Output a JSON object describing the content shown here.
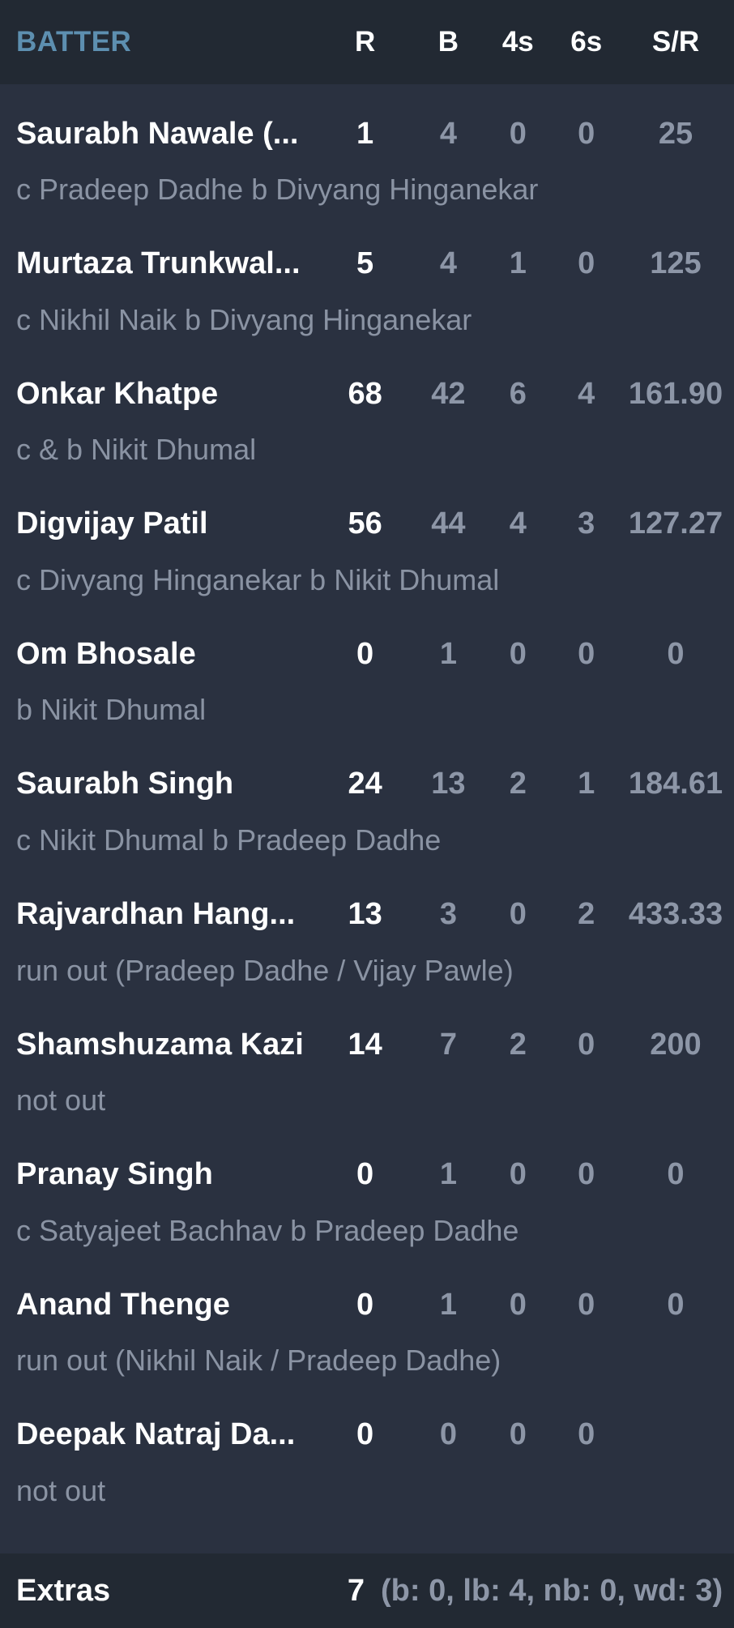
{
  "header": {
    "batter": "BATTER",
    "runs": "R",
    "balls": "B",
    "fours": "4s",
    "sixes": "6s",
    "strike_rate": "S/R"
  },
  "batters": [
    {
      "name": "Saurabh Nawale (...",
      "r": "1",
      "b": "4",
      "fours": "0",
      "sixes": "0",
      "sr": "25",
      "dismissal": "c Pradeep Dadhe b Divyang Hinganekar"
    },
    {
      "name": "Murtaza Trunkwal...",
      "r": "5",
      "b": "4",
      "fours": "1",
      "sixes": "0",
      "sr": "125",
      "dismissal": "c Nikhil Naik b Divyang Hinganekar"
    },
    {
      "name": "Onkar Khatpe",
      "r": "68",
      "b": "42",
      "fours": "6",
      "sixes": "4",
      "sr": "161.90",
      "dismissal": "c & b Nikit Dhumal"
    },
    {
      "name": "Digvijay Patil",
      "r": "56",
      "b": "44",
      "fours": "4",
      "sixes": "3",
      "sr": "127.27",
      "dismissal": "c Divyang Hinganekar b Nikit Dhumal"
    },
    {
      "name": "Om Bhosale",
      "r": "0",
      "b": "1",
      "fours": "0",
      "sixes": "0",
      "sr": "0",
      "dismissal": "b Nikit Dhumal"
    },
    {
      "name": "Saurabh Singh",
      "r": "24",
      "b": "13",
      "fours": "2",
      "sixes": "1",
      "sr": "184.61",
      "dismissal": "c Nikit Dhumal b Pradeep Dadhe"
    },
    {
      "name": "Rajvardhan Hang...",
      "r": "13",
      "b": "3",
      "fours": "0",
      "sixes": "2",
      "sr": "433.33",
      "dismissal": "run out (Pradeep Dadhe / Vijay Pawle)"
    },
    {
      "name": "Shamshuzama Kazi",
      "r": "14",
      "b": "7",
      "fours": "2",
      "sixes": "0",
      "sr": "200",
      "dismissal": "not out"
    },
    {
      "name": "Pranay Singh",
      "r": "0",
      "b": "1",
      "fours": "0",
      "sixes": "0",
      "sr": "0",
      "dismissal": "c Satyajeet Bachhav b Pradeep Dadhe"
    },
    {
      "name": "Anand Thenge",
      "r": "0",
      "b": "1",
      "fours": "0",
      "sixes": "0",
      "sr": "0",
      "dismissal": "run out (Nikhil Naik / Pradeep Dadhe)"
    },
    {
      "name": "Deepak Natraj Da...",
      "r": "0",
      "b": "0",
      "fours": "0",
      "sixes": "0",
      "sr": "",
      "dismissal": "not out"
    }
  ],
  "extras": {
    "label": "Extras",
    "total": "7",
    "detail": "(b: 0, lb: 4, nb: 0, wd: 3)"
  }
}
